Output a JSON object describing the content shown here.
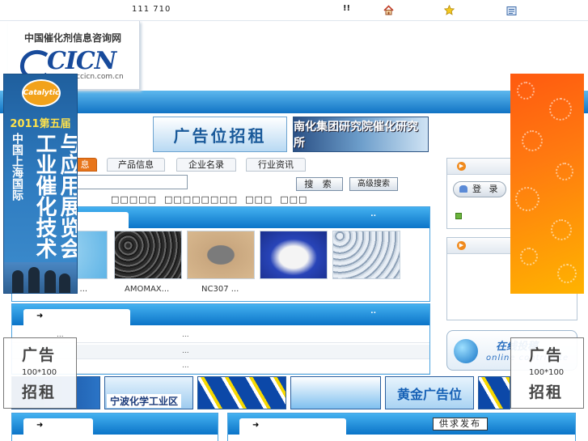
{
  "topbar": {
    "visits": "111 710",
    "marker": "!!",
    "icons": [
      "home-icon",
      "star-icon",
      "book-icon"
    ]
  },
  "logo": {
    "name": "中国催化剂信息咨询网",
    "mark": "CICN",
    "url": "ccicn.com.cn"
  },
  "left_banner": {
    "badge": "Catalytic",
    "year": "2011第五届",
    "col1": "中国上海国际",
    "col2": "工业催化技术",
    "col3": "与应用展览会"
  },
  "header_ads": {
    "ad1": "广告位招租",
    "ad2": "南化集团研究院催化研究所"
  },
  "nav_tabs": [
    {
      "label": "息"
    },
    {
      "label": "产品信息"
    },
    {
      "label": "企业名录"
    },
    {
      "label": "行业资讯"
    }
  ],
  "search": {
    "placeholder": "",
    "button": "搜 索",
    "advanced": "高级搜索",
    "options": "□□□□□  □□□□□□□□  □□□  □□□"
  },
  "products_panel": {
    "title": "",
    "dots": "..",
    "items": [
      {
        "name": "4 ..."
      },
      {
        "name": "AMOMAX..."
      },
      {
        "name": "NC307 ..."
      },
      {
        "name": ""
      },
      {
        "name": ""
      }
    ]
  },
  "news_panel": {
    "dots": "..",
    "rows": [
      {
        "a": "...",
        "b": "..."
      },
      {
        "a": "...",
        "b": ""
      },
      {
        "a": "...",
        "b": ""
      }
    ]
  },
  "sidebar": {
    "login_label": "登 录",
    "submit_title": "在线投稿",
    "submit_subtitle": "online contribute"
  },
  "ad_placeholder": {
    "line1": "广告",
    "size": "100*100",
    "line2": "招租"
  },
  "bottom_ads": {
    "tile2": "宁波化学工业区",
    "tile5": "黄金广告位"
  },
  "supply_button": "供求发布",
  "colors": {
    "accent_blue": "#0b74c8",
    "accent_orange": "#e8751a",
    "banner_orange": "#ff7a10"
  }
}
